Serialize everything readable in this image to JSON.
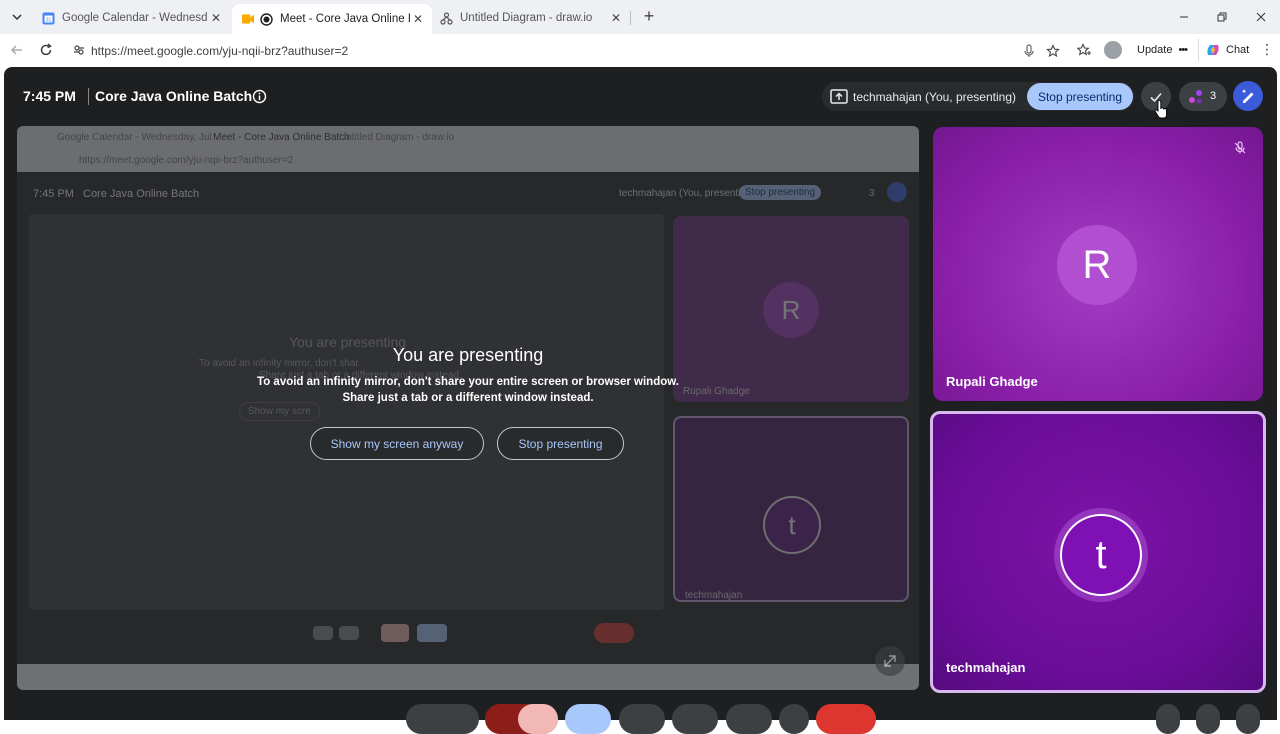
{
  "browser": {
    "tabs": [
      {
        "title": "Google Calendar - Wednesday, Jul",
        "active": false,
        "icon": "calendar-favicon"
      },
      {
        "title": "Meet - Core Java Online Batch",
        "active": true,
        "icon": "meet-favicon"
      },
      {
        "title": "Untitled Diagram - draw.io",
        "active": false,
        "icon": "drawio-favicon"
      }
    ],
    "url": "https://meet.google.com/yju-nqii-brz?authuser=2",
    "update_label": "Update",
    "chat_label": "Chat"
  },
  "meet": {
    "time": "7:45 PM",
    "meeting_title": "Core Java Online Batch",
    "presenter_label": "techmahajan (You, presenting)",
    "stop_presenting_label": "Stop presenting",
    "participant_count": "3"
  },
  "overlay": {
    "title": "You are presenting",
    "message_line1": "To avoid an infinity mirror, don't share your entire screen or browser window.",
    "message_line2": "Share just a tab or a different window instead.",
    "show_anyway_label": "Show my screen anyway",
    "stop_label": "Stop presenting"
  },
  "participants": [
    {
      "name": "Rupali Ghadge",
      "initial": "R",
      "muted": true
    },
    {
      "name": "techmahajan",
      "initial": "t",
      "speaking": true
    }
  ],
  "mirror": {
    "tab1": "Google Calendar - Wednesday, Jul",
    "tab2": "Meet - Core Java Online Batch",
    "tab3": "Untitled Diagram - draw.io",
    "url": "https://meet.google.com/yju-nqii-brz?authuser=2",
    "time": "7:45 PM",
    "title": "Core Java Online Batch",
    "presenter": "techmahajan (You, presenting)",
    "stop": "Stop presenting",
    "count": "3",
    "name1": "Rupali Ghadge",
    "name2": "techmahajan",
    "initial1": "R",
    "initial2": "t",
    "heading": "You are presenting",
    "msg1": "To avoid an infinity mirror, don't shar",
    "msg2": "Share just a tab or a different window instead.",
    "btn": "Show my scre"
  }
}
